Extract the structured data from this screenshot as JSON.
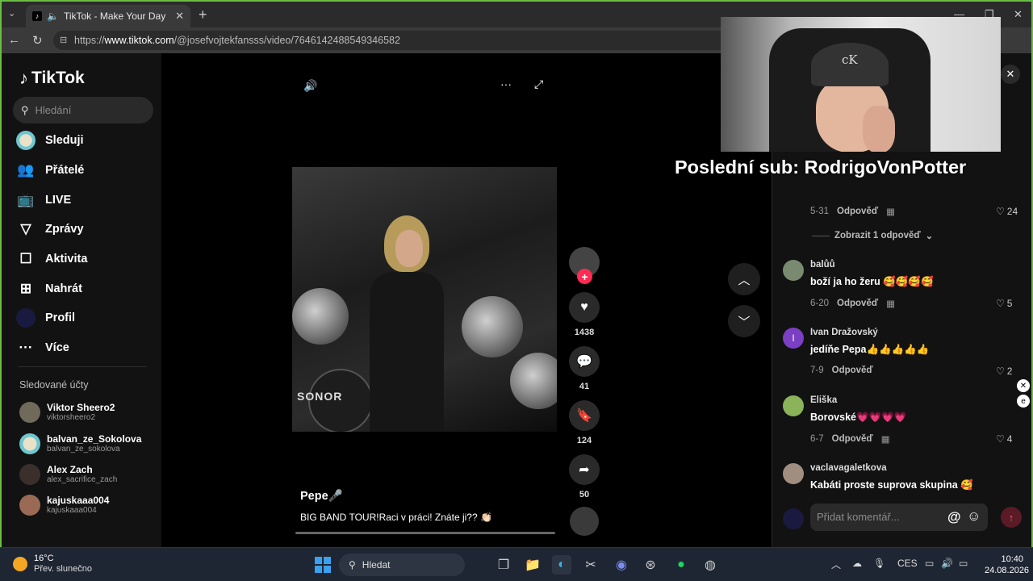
{
  "browser": {
    "tab_title": "TikTok - Make Your Day",
    "url_host": "www.tiktok.com",
    "url_path": "/@josefvojtekfansss/video/7646142488549346582",
    "url_scheme": "https://"
  },
  "sidebar": {
    "logo": "TikTok",
    "search_placeholder": "Hledání",
    "menu": [
      {
        "label": "Sleduji",
        "icon": "following-avatar-icon"
      },
      {
        "label": "Přátelé",
        "icon": "friends-icon"
      },
      {
        "label": "LIVE",
        "icon": "live-tv-icon"
      },
      {
        "label": "Zprávy",
        "icon": "messages-icon"
      },
      {
        "label": "Aktivita",
        "icon": "activity-icon"
      },
      {
        "label": "Nahrát",
        "icon": "upload-icon"
      },
      {
        "label": "Profil",
        "icon": "profile-avatar-icon"
      },
      {
        "label": "Více",
        "icon": "more-icon"
      }
    ],
    "followed_title": "Sledované účty",
    "followed": [
      {
        "name": "Viktor Sheero2",
        "id": "viktorsheero2"
      },
      {
        "name": "balvan_ze_Sokolova",
        "id": "balvan_ze_sokolova"
      },
      {
        "name": "Alex Zach",
        "id": "alex_sacrifice_zach"
      },
      {
        "name": "kajuskaaa004",
        "id": "kajuskaaa004"
      }
    ]
  },
  "video": {
    "brand_text": "SONOR",
    "caption_title": "Pepe🎤",
    "caption_text": "BIG BAND TOUR!Raci v práci! Znáte ji?? 👏🏻",
    "actions": {
      "likes": "1438",
      "comments": "41",
      "saves": "124",
      "shares": "50"
    }
  },
  "overlay": {
    "last_sub": "Poslední sub: RodrigoVonPotter",
    "cap_brand": "cK"
  },
  "comments": {
    "first_meta": {
      "date": "5-31",
      "reply": "Odpověď",
      "likes": "24"
    },
    "show_replies": "Zobrazit 1 odpověď",
    "items": [
      {
        "user": "balůů",
        "text": "boží ja ho žeru 🥰🥰🥰🥰",
        "date": "6-20",
        "reply": "Odpověď",
        "likes": "5",
        "avatar": ""
      },
      {
        "user": "Ivan Dražovský",
        "text": "jedíňe Pepa👍👍👍👍👍",
        "date": "7-9",
        "reply": "Odpověď",
        "likes": "2",
        "avatar": "I"
      },
      {
        "user": "Eliška",
        "text": "Borovské💗💗💗💗",
        "date": "6-7",
        "reply": "Odpověď",
        "likes": "4",
        "avatar": ""
      },
      {
        "user": "vaclavagaletkova",
        "text": "Kabáti proste suprova skupina 🥰",
        "date": "",
        "reply": "",
        "likes": "",
        "avatar": ""
      }
    ],
    "composer_placeholder": "Přidat komentář..."
  },
  "taskbar": {
    "temp": "16°C",
    "weather": "Přev. slunečno",
    "search": "Hledat",
    "lang": "CES",
    "time": "10:40",
    "date": "24.08.2026"
  },
  "colors": {
    "accent": "#fe2c55",
    "frame_green": "#6bbd45"
  }
}
